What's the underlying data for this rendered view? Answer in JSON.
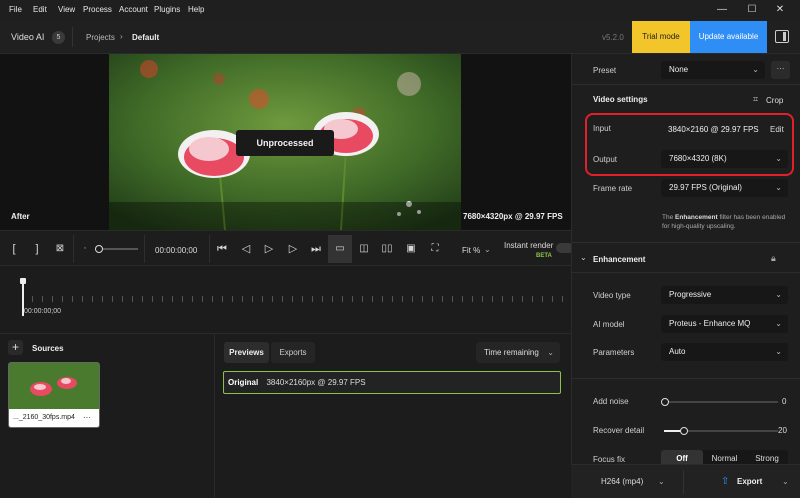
{
  "menu": [
    "File",
    "Edit",
    "View",
    "Process",
    "Account",
    "Plugins",
    "Help"
  ],
  "window_controls": {
    "minimize": "—",
    "maximize": "☐",
    "close": "✕"
  },
  "header": {
    "app_name": "Video AI",
    "version_badge": "5",
    "breadcrumb_root": "Projects",
    "breadcrumb_current": "Default",
    "version_text": "v5.2.0",
    "trial_label": "Trial mode",
    "update_label": "Update available",
    "colors": {
      "trial": "#f2c52b",
      "update": "#2f8ef5"
    }
  },
  "preview": {
    "overlay_label": "Unprocessed",
    "mode_label": "After",
    "resolution_readout": "7680×4320px @ 29.97 FPS"
  },
  "controls": {
    "timecode": "00:00:00;00",
    "fit_label": "Fit %",
    "instant_render_label": "Instant render",
    "beta_label": "BETA"
  },
  "timeline": {
    "timecode": "00:00:00;00"
  },
  "sources": {
    "title": "Sources",
    "file_name": "..._2160_30fps.mp4",
    "more": "···"
  },
  "previews_panel": {
    "tabs": [
      "Previews",
      "Exports"
    ],
    "sort_label": "Time remaining",
    "row_label": "Original",
    "row_value": "3840×2160px @ 29.97 FPS"
  },
  "right_panel": {
    "preset_label": "Preset",
    "preset_value": "None",
    "video_settings_title": "Video settings",
    "crop_label": "Crop",
    "input_label": "Input",
    "input_value": "3840×2160 @ 29.97 FPS",
    "edit_label": "Edit",
    "output_label": "Output",
    "output_value": "7680×4320 (8K)",
    "frame_rate_label": "Frame rate",
    "frame_rate_value": "29.97 FPS (Original)",
    "note_prefix": "The ",
    "note_bold": "Enhancement",
    "note_rest": " filter has been enabled",
    "note_line2": "for high-quality upscaling.",
    "enhancement_title": "Enhancement",
    "video_type_label": "Video type",
    "video_type_value": "Progressive",
    "ai_model_label": "AI model",
    "ai_model_value": "Proteus - Enhance MQ",
    "parameters_label": "Parameters",
    "parameters_value": "Auto",
    "add_noise_label": "Add noise",
    "add_noise_value": "0",
    "add_noise_level": 0,
    "recover_detail_label": "Recover detail",
    "recover_detail_value": "20",
    "recover_detail_level": 0.2,
    "focus_fix_label": "Focus fix",
    "focus_fix_options": [
      "Off",
      "Normal",
      "Strong"
    ],
    "highlight_color": "#e0202a"
  },
  "bottom_bar": {
    "codec_label": "H264 (mp4)",
    "export_label": "Export"
  }
}
